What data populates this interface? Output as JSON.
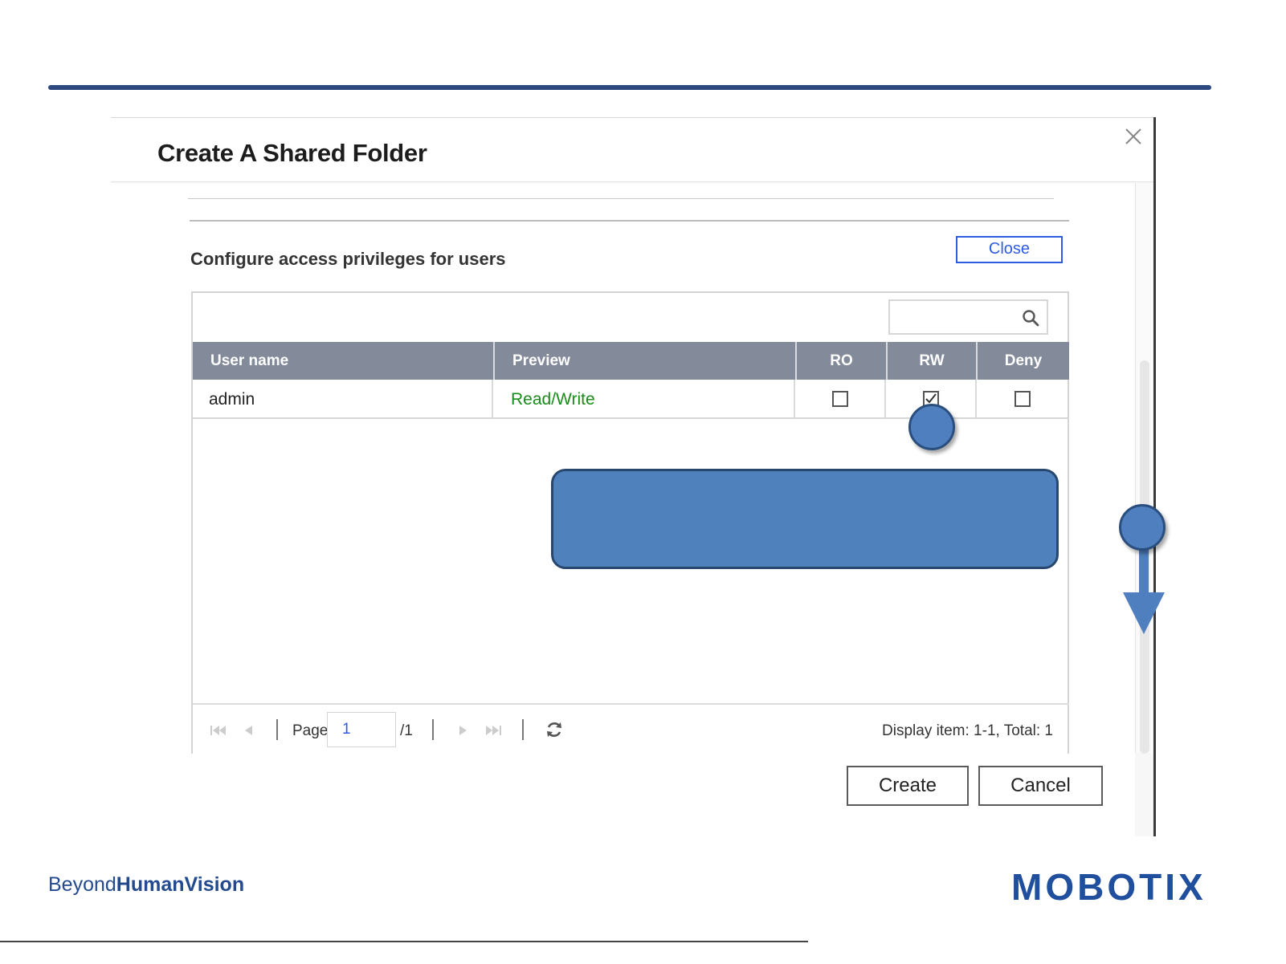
{
  "dialog": {
    "title": "Create A Shared Folder",
    "close_icon": "close-icon"
  },
  "section": {
    "title": "Configure access privileges for users",
    "close_label": "Close"
  },
  "search": {
    "placeholder": "",
    "icon": "search-icon"
  },
  "table": {
    "columns": [
      "User name",
      "Preview",
      "RO",
      "RW",
      "Deny"
    ],
    "rows": [
      {
        "user_name": "admin",
        "preview": "Read/Write",
        "ro": false,
        "rw": true,
        "deny": false
      }
    ]
  },
  "pager": {
    "page_label": "Page",
    "page_value": "1",
    "total_pages": "/1",
    "display_info": "Display item: 1-1, Total: 1"
  },
  "actions": {
    "create_label": "Create",
    "cancel_label": "Cancel"
  },
  "branding": {
    "tagline_1": "Beyond",
    "tagline_2": "Human",
    "tagline_3": "Vision",
    "logo": "MOBOTIX"
  },
  "colors": {
    "accent_blue": "#2e5ce0",
    "preview_green": "#1a8c1a",
    "header_gray": "#838b9b",
    "callout_blue": "#4f81bd",
    "brand_blue": "#1f4f9d"
  }
}
